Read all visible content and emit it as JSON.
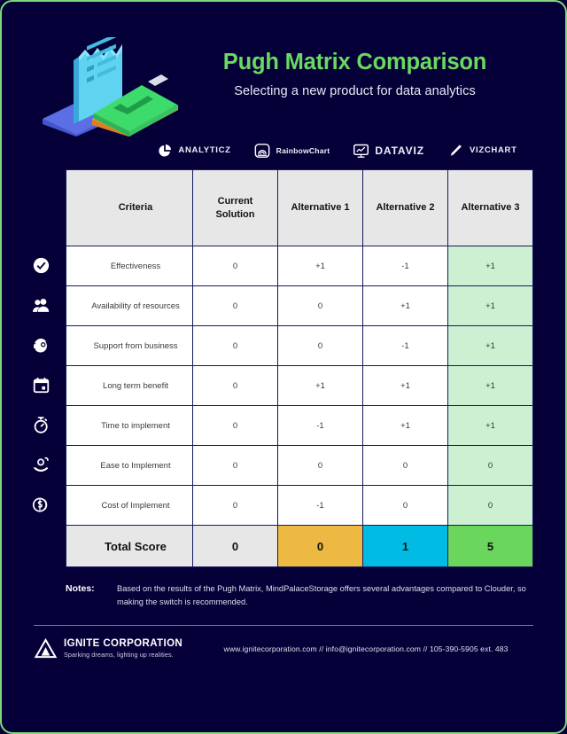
{
  "theme": {
    "background": "#050038",
    "border": "#7ed97a",
    "accent_green": "#69d95f",
    "header_gray": "#e7e7e7",
    "mint": "#cdf0d3",
    "amber": "#edb942",
    "cyan": "#00bce4",
    "green": "#6ad75c"
  },
  "header": {
    "title": "Pugh Matrix Comparison",
    "subtitle": "Selecting a new product for data analytics",
    "illustration_name": "isometric-document-and-clipboard"
  },
  "logos": [
    {
      "icon": "pie-chart-icon",
      "name": "ANALYTICZ",
      "style": "caps"
    },
    {
      "icon": "rainbow-arch-icon",
      "name": "RainbowChart",
      "style": "mixed"
    },
    {
      "icon": "monitor-chart-icon",
      "name": "DATAVIZ",
      "style": "big"
    },
    {
      "icon": "pencil-icon",
      "name": "VIZCHART",
      "style": "caps"
    }
  ],
  "table": {
    "columns": [
      "Criteria",
      "Current Solution",
      "Alternative 1",
      "Alternative 2",
      "Alternative 3"
    ],
    "column_labels_multiline": {
      "current_solution_line1": "Current",
      "current_solution_line2": "Solution"
    },
    "highlight_column_index": 4,
    "rows": [
      {
        "icon": "check-circle-icon",
        "criteria": "Effectiveness",
        "current": "0",
        "alt1": "+1",
        "alt2": "-1",
        "alt3": "+1"
      },
      {
        "icon": "users-icon",
        "criteria": "Availability of resources",
        "current": "0",
        "alt1": "0",
        "alt2": "+1",
        "alt3": "+1"
      },
      {
        "icon": "headset-icon",
        "criteria": "Support from business",
        "current": "0",
        "alt1": "0",
        "alt2": "-1",
        "alt3": "+1"
      },
      {
        "icon": "calendar-icon",
        "criteria": "Long term benefit",
        "current": "0",
        "alt1": "+1",
        "alt2": "+1",
        "alt3": "+1"
      },
      {
        "icon": "stopwatch-icon",
        "criteria": "Time to implement",
        "current": "0",
        "alt1": "-1",
        "alt2": "+1",
        "alt3": "+1"
      },
      {
        "icon": "hand-coin-icon",
        "criteria": "Ease to Implement",
        "current": "0",
        "alt1": "0",
        "alt2": "0",
        "alt3": "0"
      },
      {
        "icon": "dollar-coin-icon",
        "criteria": "Cost of Implement",
        "current": "0",
        "alt1": "-1",
        "alt2": "0",
        "alt3": "0"
      }
    ],
    "total": {
      "label": "Total Score",
      "current": "0",
      "alt1": "0",
      "alt2": "1",
      "alt3": "5"
    }
  },
  "notes": {
    "label": "Notes:",
    "text": "Based on the results of the Pugh Matrix, MindPalaceStorage offers several advantages compared to Clouder, so making the switch is recommended."
  },
  "footer": {
    "logo_icon": "triangle-logo-icon",
    "company": "IGNITE CORPORATION",
    "tagline": "Sparking dreams, lighting up realities.",
    "contact": "www.ignitecorporation.com // info@ignitecorporation.com // 105-390-5905 ext. 483"
  }
}
